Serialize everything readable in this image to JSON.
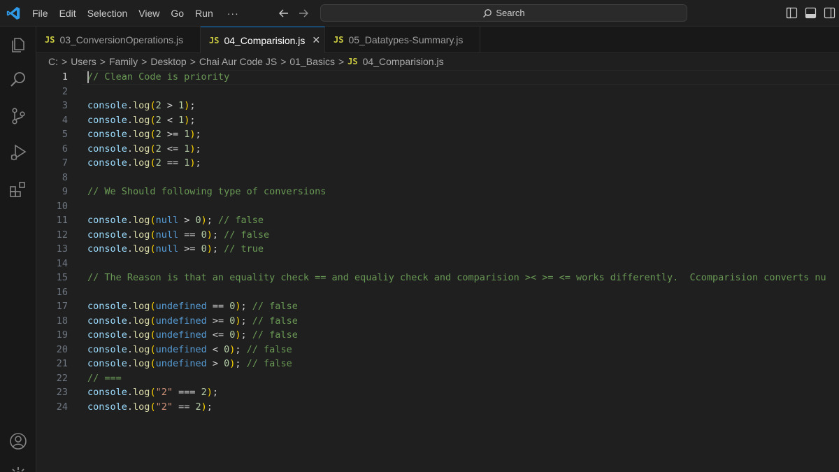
{
  "menu": [
    "File",
    "Edit",
    "Selection",
    "View",
    "Go",
    "Run"
  ],
  "menu_more": "···",
  "search": {
    "label": "Search"
  },
  "tabs": [
    {
      "badge": "JS",
      "label": "03_ConversionOperations.js"
    },
    {
      "badge": "JS",
      "label": "04_Comparision.js",
      "close": "✕"
    },
    {
      "badge": "JS",
      "label": "05_Datatypes-Summary.js"
    }
  ],
  "breadcrumb": {
    "parts": [
      "C:",
      "Users",
      "Family",
      "Desktop",
      "Chai Aur Code JS",
      "01_Basics"
    ],
    "separator": ">",
    "file_badge": "JS",
    "file": "04_Comparision.js"
  },
  "editor": {
    "current_line": 1,
    "lines": [
      {
        "n": "1",
        "tokens": [
          [
            "com",
            "// Clean Code is priority"
          ]
        ]
      },
      {
        "n": "2",
        "tokens": []
      },
      {
        "n": "3",
        "tokens": [
          [
            "obj",
            "console"
          ],
          [
            "op",
            "."
          ],
          [
            "fn",
            "log"
          ],
          [
            "br",
            "("
          ],
          [
            "num",
            "2"
          ],
          [
            "op",
            " > "
          ],
          [
            "num",
            "1"
          ],
          [
            "br",
            ")"
          ],
          [
            "op",
            ";"
          ]
        ]
      },
      {
        "n": "4",
        "tokens": [
          [
            "obj",
            "console"
          ],
          [
            "op",
            "."
          ],
          [
            "fn",
            "log"
          ],
          [
            "br",
            "("
          ],
          [
            "num",
            "2"
          ],
          [
            "op",
            " < "
          ],
          [
            "num",
            "1"
          ],
          [
            "br",
            ")"
          ],
          [
            "op",
            ";"
          ]
        ]
      },
      {
        "n": "5",
        "tokens": [
          [
            "obj",
            "console"
          ],
          [
            "op",
            "."
          ],
          [
            "fn",
            "log"
          ],
          [
            "br",
            "("
          ],
          [
            "num",
            "2"
          ],
          [
            "op",
            " >= "
          ],
          [
            "num",
            "1"
          ],
          [
            "br",
            ")"
          ],
          [
            "op",
            ";"
          ]
        ]
      },
      {
        "n": "6",
        "tokens": [
          [
            "obj",
            "console"
          ],
          [
            "op",
            "."
          ],
          [
            "fn",
            "log"
          ],
          [
            "br",
            "("
          ],
          [
            "num",
            "2"
          ],
          [
            "op",
            " <= "
          ],
          [
            "num",
            "1"
          ],
          [
            "br",
            ")"
          ],
          [
            "op",
            ";"
          ]
        ]
      },
      {
        "n": "7",
        "tokens": [
          [
            "obj",
            "console"
          ],
          [
            "op",
            "."
          ],
          [
            "fn",
            "log"
          ],
          [
            "br",
            "("
          ],
          [
            "num",
            "2"
          ],
          [
            "op",
            " == "
          ],
          [
            "num",
            "1"
          ],
          [
            "br",
            ")"
          ],
          [
            "op",
            ";"
          ]
        ]
      },
      {
        "n": "8",
        "tokens": []
      },
      {
        "n": "9",
        "tokens": [
          [
            "com",
            "// We Should following type of conversions"
          ]
        ]
      },
      {
        "n": "10",
        "tokens": []
      },
      {
        "n": "11",
        "tokens": [
          [
            "obj",
            "console"
          ],
          [
            "op",
            "."
          ],
          [
            "fn",
            "log"
          ],
          [
            "br",
            "("
          ],
          [
            "kw",
            "null"
          ],
          [
            "op",
            " > "
          ],
          [
            "num",
            "0"
          ],
          [
            "br",
            ")"
          ],
          [
            "op",
            "; "
          ],
          [
            "com",
            "// false"
          ]
        ]
      },
      {
        "n": "12",
        "tokens": [
          [
            "obj",
            "console"
          ],
          [
            "op",
            "."
          ],
          [
            "fn",
            "log"
          ],
          [
            "br",
            "("
          ],
          [
            "kw",
            "null"
          ],
          [
            "op",
            " == "
          ],
          [
            "num",
            "0"
          ],
          [
            "br",
            ")"
          ],
          [
            "op",
            "; "
          ],
          [
            "com",
            "// false"
          ]
        ]
      },
      {
        "n": "13",
        "tokens": [
          [
            "obj",
            "console"
          ],
          [
            "op",
            "."
          ],
          [
            "fn",
            "log"
          ],
          [
            "br",
            "("
          ],
          [
            "kw",
            "null"
          ],
          [
            "op",
            " >= "
          ],
          [
            "num",
            "0"
          ],
          [
            "br",
            ")"
          ],
          [
            "op",
            "; "
          ],
          [
            "com",
            "// true"
          ]
        ]
      },
      {
        "n": "14",
        "tokens": []
      },
      {
        "n": "15",
        "tokens": [
          [
            "com",
            "// The Reason is that an equality check == and equaliy check and comparision >< >= <= works differently.  Ccomparision converts nu"
          ]
        ]
      },
      {
        "n": "16",
        "tokens": []
      },
      {
        "n": "17",
        "tokens": [
          [
            "obj",
            "console"
          ],
          [
            "op",
            "."
          ],
          [
            "fn",
            "log"
          ],
          [
            "br",
            "("
          ],
          [
            "kw",
            "undefined"
          ],
          [
            "op",
            " == "
          ],
          [
            "num",
            "0"
          ],
          [
            "br",
            ")"
          ],
          [
            "op",
            "; "
          ],
          [
            "com",
            "// false"
          ]
        ]
      },
      {
        "n": "18",
        "tokens": [
          [
            "obj",
            "console"
          ],
          [
            "op",
            "."
          ],
          [
            "fn",
            "log"
          ],
          [
            "br",
            "("
          ],
          [
            "kw",
            "undefined"
          ],
          [
            "op",
            " >= "
          ],
          [
            "num",
            "0"
          ],
          [
            "br",
            ")"
          ],
          [
            "op",
            "; "
          ],
          [
            "com",
            "// false"
          ]
        ]
      },
      {
        "n": "19",
        "tokens": [
          [
            "obj",
            "console"
          ],
          [
            "op",
            "."
          ],
          [
            "fn",
            "log"
          ],
          [
            "br",
            "("
          ],
          [
            "kw",
            "undefined"
          ],
          [
            "op",
            " <= "
          ],
          [
            "num",
            "0"
          ],
          [
            "br",
            ")"
          ],
          [
            "op",
            "; "
          ],
          [
            "com",
            "// false"
          ]
        ]
      },
      {
        "n": "20",
        "tokens": [
          [
            "obj",
            "console"
          ],
          [
            "op",
            "."
          ],
          [
            "fn",
            "log"
          ],
          [
            "br",
            "("
          ],
          [
            "kw",
            "undefined"
          ],
          [
            "op",
            " < "
          ],
          [
            "num",
            "0"
          ],
          [
            "br",
            ")"
          ],
          [
            "op",
            "; "
          ],
          [
            "com",
            "// false"
          ]
        ]
      },
      {
        "n": "21",
        "tokens": [
          [
            "obj",
            "console"
          ],
          [
            "op",
            "."
          ],
          [
            "fn",
            "log"
          ],
          [
            "br",
            "("
          ],
          [
            "kw",
            "undefined"
          ],
          [
            "op",
            " > "
          ],
          [
            "num",
            "0"
          ],
          [
            "br",
            ")"
          ],
          [
            "op",
            "; "
          ],
          [
            "com",
            "// false"
          ]
        ]
      },
      {
        "n": "22",
        "tokens": [
          [
            "com",
            "// ==="
          ]
        ]
      },
      {
        "n": "23",
        "tokens": [
          [
            "obj",
            "console"
          ],
          [
            "op",
            "."
          ],
          [
            "fn",
            "log"
          ],
          [
            "br",
            "("
          ],
          [
            "str",
            "\"2\""
          ],
          [
            "op",
            " === "
          ],
          [
            "num",
            "2"
          ],
          [
            "br",
            ")"
          ],
          [
            "op",
            ";"
          ]
        ]
      },
      {
        "n": "24",
        "tokens": [
          [
            "obj",
            "console"
          ],
          [
            "op",
            "."
          ],
          [
            "fn",
            "log"
          ],
          [
            "br",
            "("
          ],
          [
            "str",
            "\"2\""
          ],
          [
            "op",
            " == "
          ],
          [
            "num",
            "2"
          ],
          [
            "br",
            ")"
          ],
          [
            "op",
            ";"
          ]
        ]
      }
    ]
  },
  "colors": {
    "accent": "#0078d4",
    "js_badge": "#cbcb41",
    "comment": "#6a9955",
    "keyword": "#569cd6",
    "function": "#dcdcaa",
    "number": "#b5cea8",
    "string": "#ce9178"
  },
  "icons": {
    "app": "vscode-logo-icon",
    "activity": [
      "explorer-icon",
      "search-icon",
      "source-control-icon",
      "run-debug-icon",
      "extensions-icon",
      "account-icon",
      "manage-gear-icon"
    ]
  }
}
